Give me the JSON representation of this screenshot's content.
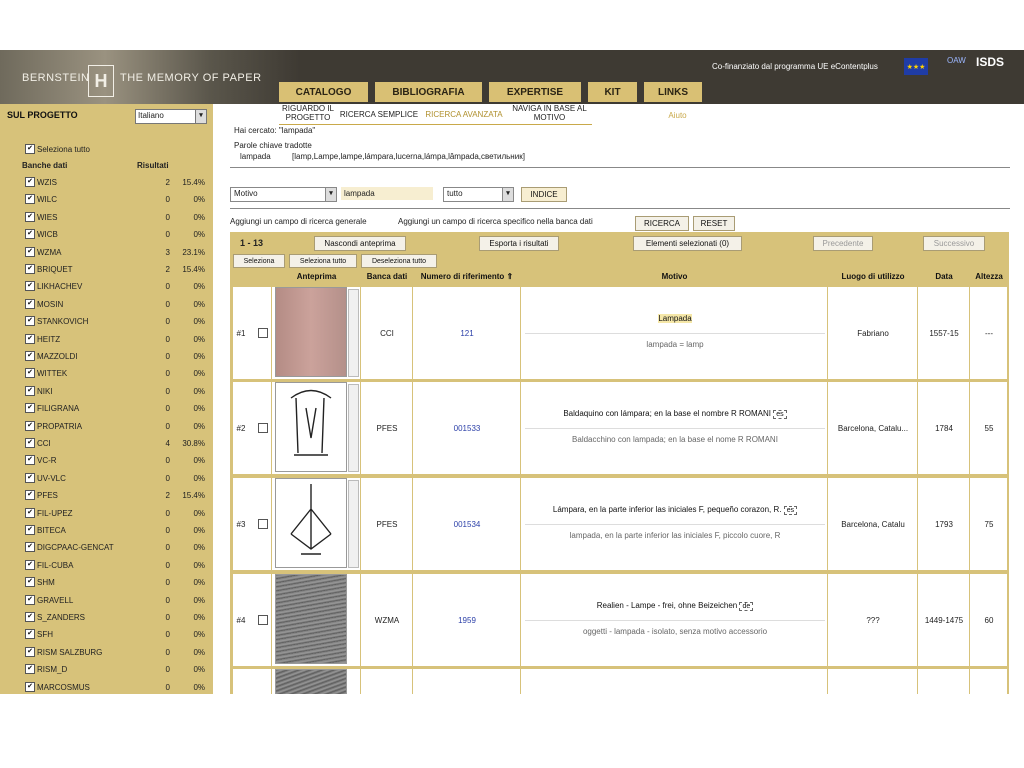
{
  "header": {
    "brand_left": "BERNSTEIN",
    "brand_mark": "H",
    "brand_right": "THE MEMORY OF PAPER",
    "cofinanced": "Co-finanziato dal programma UE eContentplus",
    "eu_flag": "★★★",
    "oaw": "OAW",
    "isds": "ISDS"
  },
  "nav": {
    "tabs": [
      "CATALOGO",
      "BIBLIOGRAFIA",
      "EXPERTISE",
      "KIT",
      "LINKS"
    ]
  },
  "subnav": {
    "items": [
      "RIGUARDO IL PROGETTO",
      "RICERCA SEMPLICE",
      "RICERCA AVANZATA",
      "NAVIGA IN BASE AL MOTIVO"
    ],
    "help": "Aiuto"
  },
  "sidebar": {
    "title": "SUL PROGETTO",
    "language": "Italiano",
    "select_all": "Seleziona tutto",
    "col_db": "Banche dati",
    "col_results": "Risultati",
    "rows": [
      {
        "name": "WZIS",
        "count": "2",
        "pct": "15.4%"
      },
      {
        "name": "WILC",
        "count": "0",
        "pct": "0%"
      },
      {
        "name": "WIES",
        "count": "0",
        "pct": "0%"
      },
      {
        "name": "WICB",
        "count": "0",
        "pct": "0%"
      },
      {
        "name": "WZMA",
        "count": "3",
        "pct": "23.1%"
      },
      {
        "name": "BRIQUET",
        "count": "2",
        "pct": "15.4%"
      },
      {
        "name": "LIKHACHEV",
        "count": "0",
        "pct": "0%"
      },
      {
        "name": "MOSIN",
        "count": "0",
        "pct": "0%"
      },
      {
        "name": "STANKOVICH",
        "count": "0",
        "pct": "0%"
      },
      {
        "name": "HEITZ",
        "count": "0",
        "pct": "0%"
      },
      {
        "name": "MAZZOLDI",
        "count": "0",
        "pct": "0%"
      },
      {
        "name": "WITTEK",
        "count": "0",
        "pct": "0%"
      },
      {
        "name": "NIKI",
        "count": "0",
        "pct": "0%"
      },
      {
        "name": "FILIGRANA",
        "count": "0",
        "pct": "0%"
      },
      {
        "name": "PROPATRIA",
        "count": "0",
        "pct": "0%"
      },
      {
        "name": "CCI",
        "count": "4",
        "pct": "30.8%"
      },
      {
        "name": "VC-R",
        "count": "0",
        "pct": "0%"
      },
      {
        "name": "UV-VLC",
        "count": "0",
        "pct": "0%"
      },
      {
        "name": "PFES",
        "count": "2",
        "pct": "15.4%"
      },
      {
        "name": "FIL-UPEZ",
        "count": "0",
        "pct": "0%"
      },
      {
        "name": "BITECA",
        "count": "0",
        "pct": "0%"
      },
      {
        "name": "DIGCPAAC-GENCAT",
        "count": "0",
        "pct": "0%"
      },
      {
        "name": "FIL-CUBA",
        "count": "0",
        "pct": "0%"
      },
      {
        "name": "SHM",
        "count": "0",
        "pct": "0%"
      },
      {
        "name": "GRAVELL",
        "count": "0",
        "pct": "0%"
      },
      {
        "name": "S_ZANDERS",
        "count": "0",
        "pct": "0%"
      },
      {
        "name": "SFH",
        "count": "0",
        "pct": "0%"
      },
      {
        "name": "RISM SALZBURG",
        "count": "0",
        "pct": "0%"
      },
      {
        "name": "RISM_D",
        "count": "0",
        "pct": "0%"
      },
      {
        "name": "MARCOSMUS",
        "count": "0",
        "pct": "0%"
      }
    ]
  },
  "search_info": {
    "searched_for": "Hai cercato: \"lampada\"",
    "translated_label": "Parole chiave tradotte",
    "translated_key": "lampada",
    "translated_values": "[lamp,Lampe,lampe,lámpara,lucerna,lámpa,lâmpada,светильник]"
  },
  "search_row": {
    "field": "Motivo",
    "value": "lampada",
    "scope": "tutto",
    "index_button": "INDICE"
  },
  "actions": {
    "add_general": "Aggiungi un campo di ricerca generale",
    "add_specific": "Aggiungi un campo di ricerca specifico nella banca dati",
    "search": "RICERCA",
    "reset": "RESET"
  },
  "results": {
    "range": "1 - 13",
    "hide_preview": "Nascondi anteprima",
    "export": "Esporta i risultati",
    "selected": "Elementi selezionati (0)",
    "prev": "Precedente",
    "next": "Successivo",
    "select_page": "Seleziona",
    "select_all": "Seleziona tutto",
    "deselect_all": "Deseleziona tutto",
    "columns": [
      "Anteprima",
      "Banca dati",
      "Numero di riferimento ⇑",
      "Motivo",
      "Luogo di utilizzo",
      "Data",
      "Altezza"
    ],
    "rows": [
      {
        "num": "#1",
        "db": "CCI",
        "ref": "121",
        "motif_main": "Lampada",
        "motif_sub": "lampada = lamp",
        "tag": "",
        "place": "Fabriano",
        "date": "1557-15",
        "height": "---"
      },
      {
        "num": "#2",
        "db": "PFES",
        "ref": "001533",
        "motif_main": "Baldaquino con lámpara; en la base el nombre R ROMANI",
        "motif_sub": "Baldacchino con lampada; en la base el nome R ROMANI",
        "tag": "es",
        "place": "Barcelona, Catalu...",
        "date": "1784",
        "height": "55"
      },
      {
        "num": "#3",
        "db": "PFES",
        "ref": "001534",
        "motif_main": "Lámpara, en la parte inferior las iniciales F, pequeño corazon, R.",
        "motif_sub": "lampada, en la parte inferior las iniciales F, piccolo cuore, R",
        "tag": "es",
        "place": "Barcelona, Catalu",
        "date": "1793",
        "height": "75"
      },
      {
        "num": "#4",
        "db": "WZMA",
        "ref": "1959",
        "motif_main": "Realien - Lampe - frei, ohne Beizeichen",
        "motif_sub": "oggetti - lampada - isolato, senza motivo accessorio",
        "tag": "de",
        "place": "???",
        "date": "1449-1475",
        "height": "60"
      }
    ]
  },
  "colors": {
    "accent": "#d7c27a",
    "header_bg": "#3e3a33",
    "link": "#2b3fa8"
  },
  "icons": [
    "eu-flag-icon",
    "dropdown-arrow-icon",
    "checkbox-icon",
    "scroll-arrow-icon"
  ]
}
